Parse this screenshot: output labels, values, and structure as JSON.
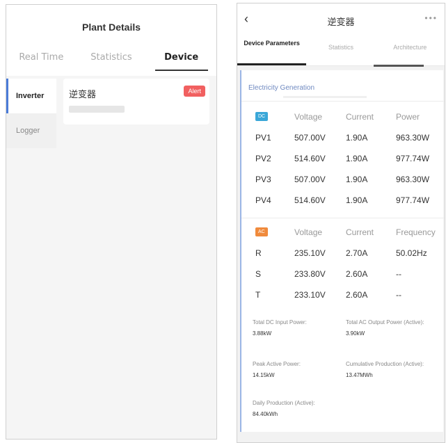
{
  "left": {
    "title": "Plant Details",
    "tabs": [
      "Real Time",
      "Statistics",
      "Device"
    ],
    "active_tab": "Device",
    "sidebar": [
      "Inverter",
      "Logger"
    ],
    "device": {
      "name": "逆变器",
      "alert": "Alert"
    }
  },
  "right": {
    "title": "逆变器",
    "back_icon": "chevron-left-icon",
    "more_icon": "more-dots-icon",
    "tabs": [
      "Device Parameters",
      "Statistics",
      "Architecture"
    ],
    "section_title": "Electricity Generation",
    "dc": {
      "badge": "DC",
      "headers": [
        "Voltage",
        "Current",
        "Power"
      ],
      "rows": [
        [
          "PV1",
          "507.00V",
          "1.90A",
          "963.30W"
        ],
        [
          "PV2",
          "514.60V",
          "1.90A",
          "977.74W"
        ],
        [
          "PV3",
          "507.00V",
          "1.90A",
          "963.30W"
        ],
        [
          "PV4",
          "514.60V",
          "1.90A",
          "977.74W"
        ]
      ]
    },
    "ac": {
      "badge": "AC",
      "headers": [
        "Voltage",
        "Current",
        "Frequency"
      ],
      "rows": [
        [
          "R",
          "235.10V",
          "2.70A",
          "50.02Hz"
        ],
        [
          "S",
          "233.80V",
          "2.60A",
          "--"
        ],
        [
          "T",
          "233.10V",
          "2.60A",
          "--"
        ]
      ]
    },
    "summary": {
      "total_dc_label": "Total DC Input Power:",
      "total_dc_value": "3.88kW",
      "total_ac_label": "Total AC Output Power (Active):",
      "total_ac_value": "3.90kW",
      "peak_label": "Peak Active Power:",
      "peak_value": "14.15kW",
      "cumulative_label": "Cumulative Production (Active):",
      "cumulative_value": "13.47MWh",
      "daily_label": "Daily Production (Active):",
      "daily_value": "84.40kWh"
    },
    "colors": {
      "dc": "#3aa7d8",
      "ac": "#f08a3c",
      "alert": "#f16060",
      "accent": "#4a7bd8"
    }
  }
}
